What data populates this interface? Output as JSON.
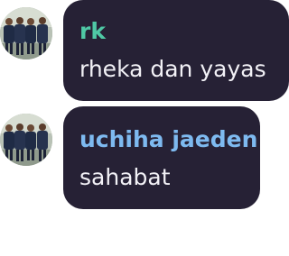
{
  "messages": [
    {
      "sender": "rk",
      "text": "rheka dan yayas",
      "name_color": "#4fc8a5",
      "avatar": "group-photo-avatar"
    },
    {
      "sender": "uchiha jaeden",
      "text": "sahabat",
      "name_color": "#7ebaf0",
      "avatar": "group-photo-avatar"
    }
  ],
  "colors": {
    "bubble": "#262135",
    "message_text": "#f2f1f6",
    "background": "#ffffff"
  }
}
